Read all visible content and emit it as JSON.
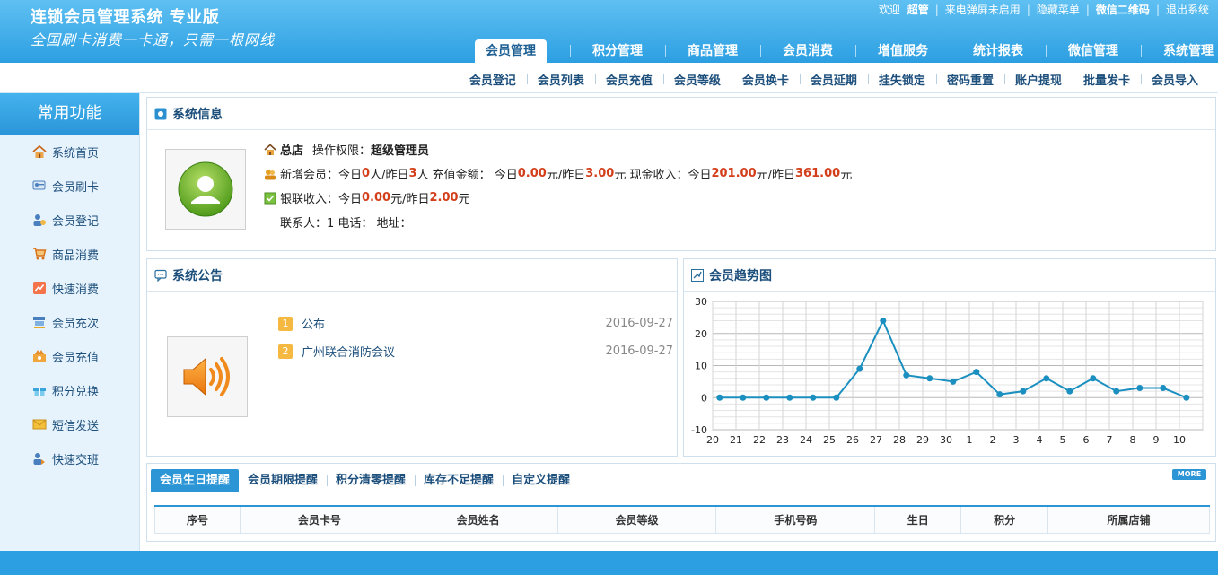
{
  "header": {
    "title": "连锁会员管理系统 专业版",
    "slogan": "全国刷卡消费一卡通，只需一根网线",
    "toplinks": [
      {
        "label": "欢迎",
        "bold": false
      },
      {
        "label": "超管",
        "bold": true
      },
      {
        "label": "来电弹屏未启用",
        "bold": false
      },
      {
        "label": "隐藏菜单",
        "bold": false
      },
      {
        "label": "微信二维码",
        "bold": true
      },
      {
        "label": "退出系统",
        "bold": false
      }
    ]
  },
  "nav": [
    "会员管理",
    "积分管理",
    "商品管理",
    "会员消费",
    "增值服务",
    "统计报表",
    "微信管理",
    "系统管理"
  ],
  "subnav": [
    "会员登记",
    "会员列表",
    "会员充值",
    "会员等级",
    "会员换卡",
    "会员延期",
    "挂失锁定",
    "密码重置",
    "账户提现",
    "批量发卡",
    "会员导入"
  ],
  "sidebar": {
    "title": "常用功能",
    "items": [
      {
        "label": "系统首页",
        "icon": "home-icon",
        "color": "#e58b2a"
      },
      {
        "label": "会员刷卡",
        "icon": "card-icon",
        "color": "#4a7fbf"
      },
      {
        "label": "会员登记",
        "icon": "user-add-icon",
        "color": "#4a7fbf"
      },
      {
        "label": "商品消费",
        "icon": "cart-icon",
        "color": "#e58b2a"
      },
      {
        "label": "快速消费",
        "icon": "chart-icon",
        "color": "#e0533a"
      },
      {
        "label": "会员充次",
        "icon": "register-icon",
        "color": "#3d7fbf"
      },
      {
        "label": "会员充值",
        "icon": "money-icon",
        "color": "#e58b2a"
      },
      {
        "label": "积分兑换",
        "icon": "gift-icon",
        "color": "#3aa5d8"
      },
      {
        "label": "短信发送",
        "icon": "mail-icon",
        "color": "#e5a92a"
      },
      {
        "label": "快速交班",
        "icon": "shift-icon",
        "color": "#4a7fbf"
      }
    ]
  },
  "sysinfo": {
    "title": "系统信息",
    "store": "总店",
    "perm_label": "操作权限：",
    "perm_value": "超级管理员",
    "line2": {
      "p1": "新增会员：今日",
      "v1": "0",
      "p2": "人/昨日",
      "v2": "3",
      "p3": "人 充值金额： 今日",
      "v3": "0.00",
      "p4": "元/昨日",
      "v4": "3.00",
      "p5": "元 现金收入：今日",
      "v5": "201.00",
      "p6": "元/昨日",
      "v6": "361.00",
      "p7": "元"
    },
    "line3": {
      "p1": "银联收入：今日",
      "v1": "0.00",
      "p2": "元/昨日",
      "v2": "2.00",
      "p3": "元"
    },
    "line4": "联系人：1  电话：  地址："
  },
  "notice": {
    "title": "系统公告",
    "items": [
      {
        "num": "1",
        "title": "公布",
        "date": "2016-09-27"
      },
      {
        "num": "2",
        "title": "广州联合消防会议",
        "date": "2016-09-27"
      }
    ]
  },
  "trend": {
    "title": "会员趋势图"
  },
  "chart_data": {
    "type": "line",
    "categories": [
      "20",
      "21",
      "22",
      "23",
      "24",
      "25",
      "26",
      "27",
      "28",
      "29",
      "30",
      "1",
      "2",
      "3",
      "4",
      "5",
      "6",
      "7",
      "8",
      "9",
      "10"
    ],
    "values": [
      0,
      0,
      0,
      0,
      0,
      0,
      9,
      24,
      7,
      6,
      5,
      8,
      1,
      2,
      6,
      2,
      6,
      2,
      3,
      3,
      0
    ],
    "ylim": [
      -10,
      30
    ],
    "yticks": [
      "30",
      "20",
      "10",
      "0",
      "-10"
    ],
    "grid": true,
    "color": "#1a8fc0"
  },
  "remind": {
    "tabs": [
      "会员生日提醒",
      "会员期限提醒",
      "积分清零提醒",
      "库存不足提醒",
      "自定义提醒"
    ],
    "more": "MORE",
    "columns": [
      "序号",
      "会员卡号",
      "会员姓名",
      "会员等级",
      "手机号码",
      "生日",
      "积分",
      "所属店铺"
    ]
  }
}
